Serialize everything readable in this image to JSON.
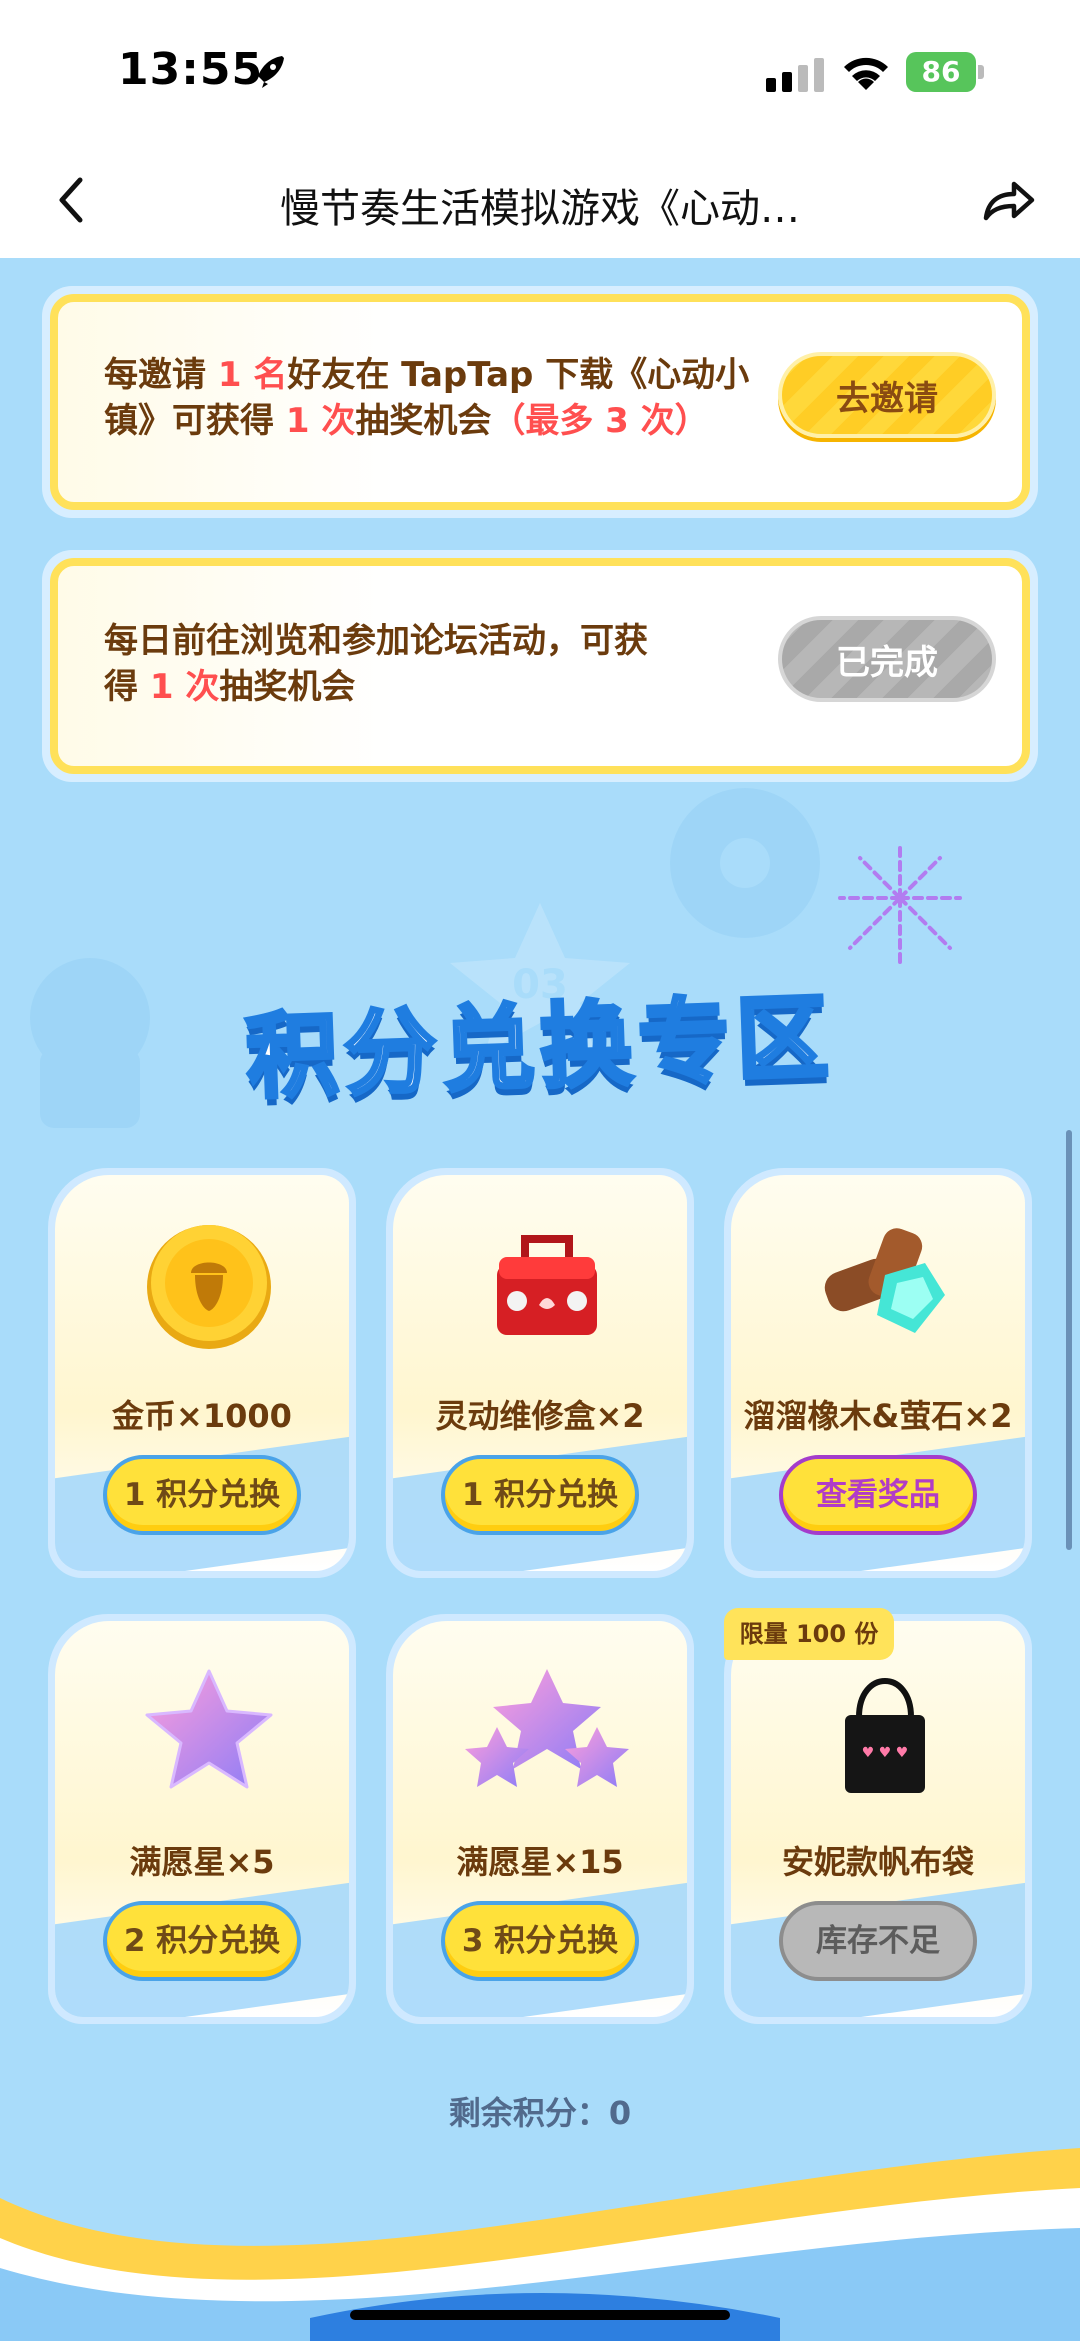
{
  "status_bar": {
    "time": "13:55",
    "battery": "86"
  },
  "nav": {
    "title": "慢节奏生活模拟游戏《心动…"
  },
  "tasks": [
    {
      "text_parts": [
        "每邀请 ",
        "1 名",
        "好友在 TapTap 下载《心动小",
        "镇》可获得 ",
        "1 次",
        "抽奖机会",
        "（最多 3 次）"
      ],
      "button": "去邀请"
    },
    {
      "text_parts": [
        "每日前往浏览和参加论坛活动，可获",
        "得 ",
        "1 次",
        "抽奖机会"
      ],
      "button": "已完成"
    }
  ],
  "section": {
    "title": "积分兑换专区",
    "star_number": "03"
  },
  "rewards": [
    {
      "name": "金币×1000",
      "button": "1 积分兑换",
      "icon": "gold-coin-icon"
    },
    {
      "name": "灵动维修盒×2",
      "button": "1 积分兑换",
      "icon": "toolbox-icon"
    },
    {
      "name": "溜溜橡木&萤石×2",
      "button": "查看奖品",
      "icon": "wood-crystal-icon"
    },
    {
      "name": "满愿星×5",
      "button": "2 积分兑换",
      "icon": "wish-star-icon"
    },
    {
      "name": "满愿星×15",
      "button": "3 积分兑换",
      "icon": "wish-stars-icon"
    },
    {
      "name": "安妮款帆布袋",
      "button": "库存不足",
      "icon": "tote-bag-icon",
      "tag": "限量 100 份"
    }
  ],
  "remaining": {
    "label": "剩余积分：",
    "value": "0"
  },
  "colors": {
    "accent": "#ffe13a",
    "highlight": "#ff4f4f",
    "background": "#a9dcfa"
  }
}
